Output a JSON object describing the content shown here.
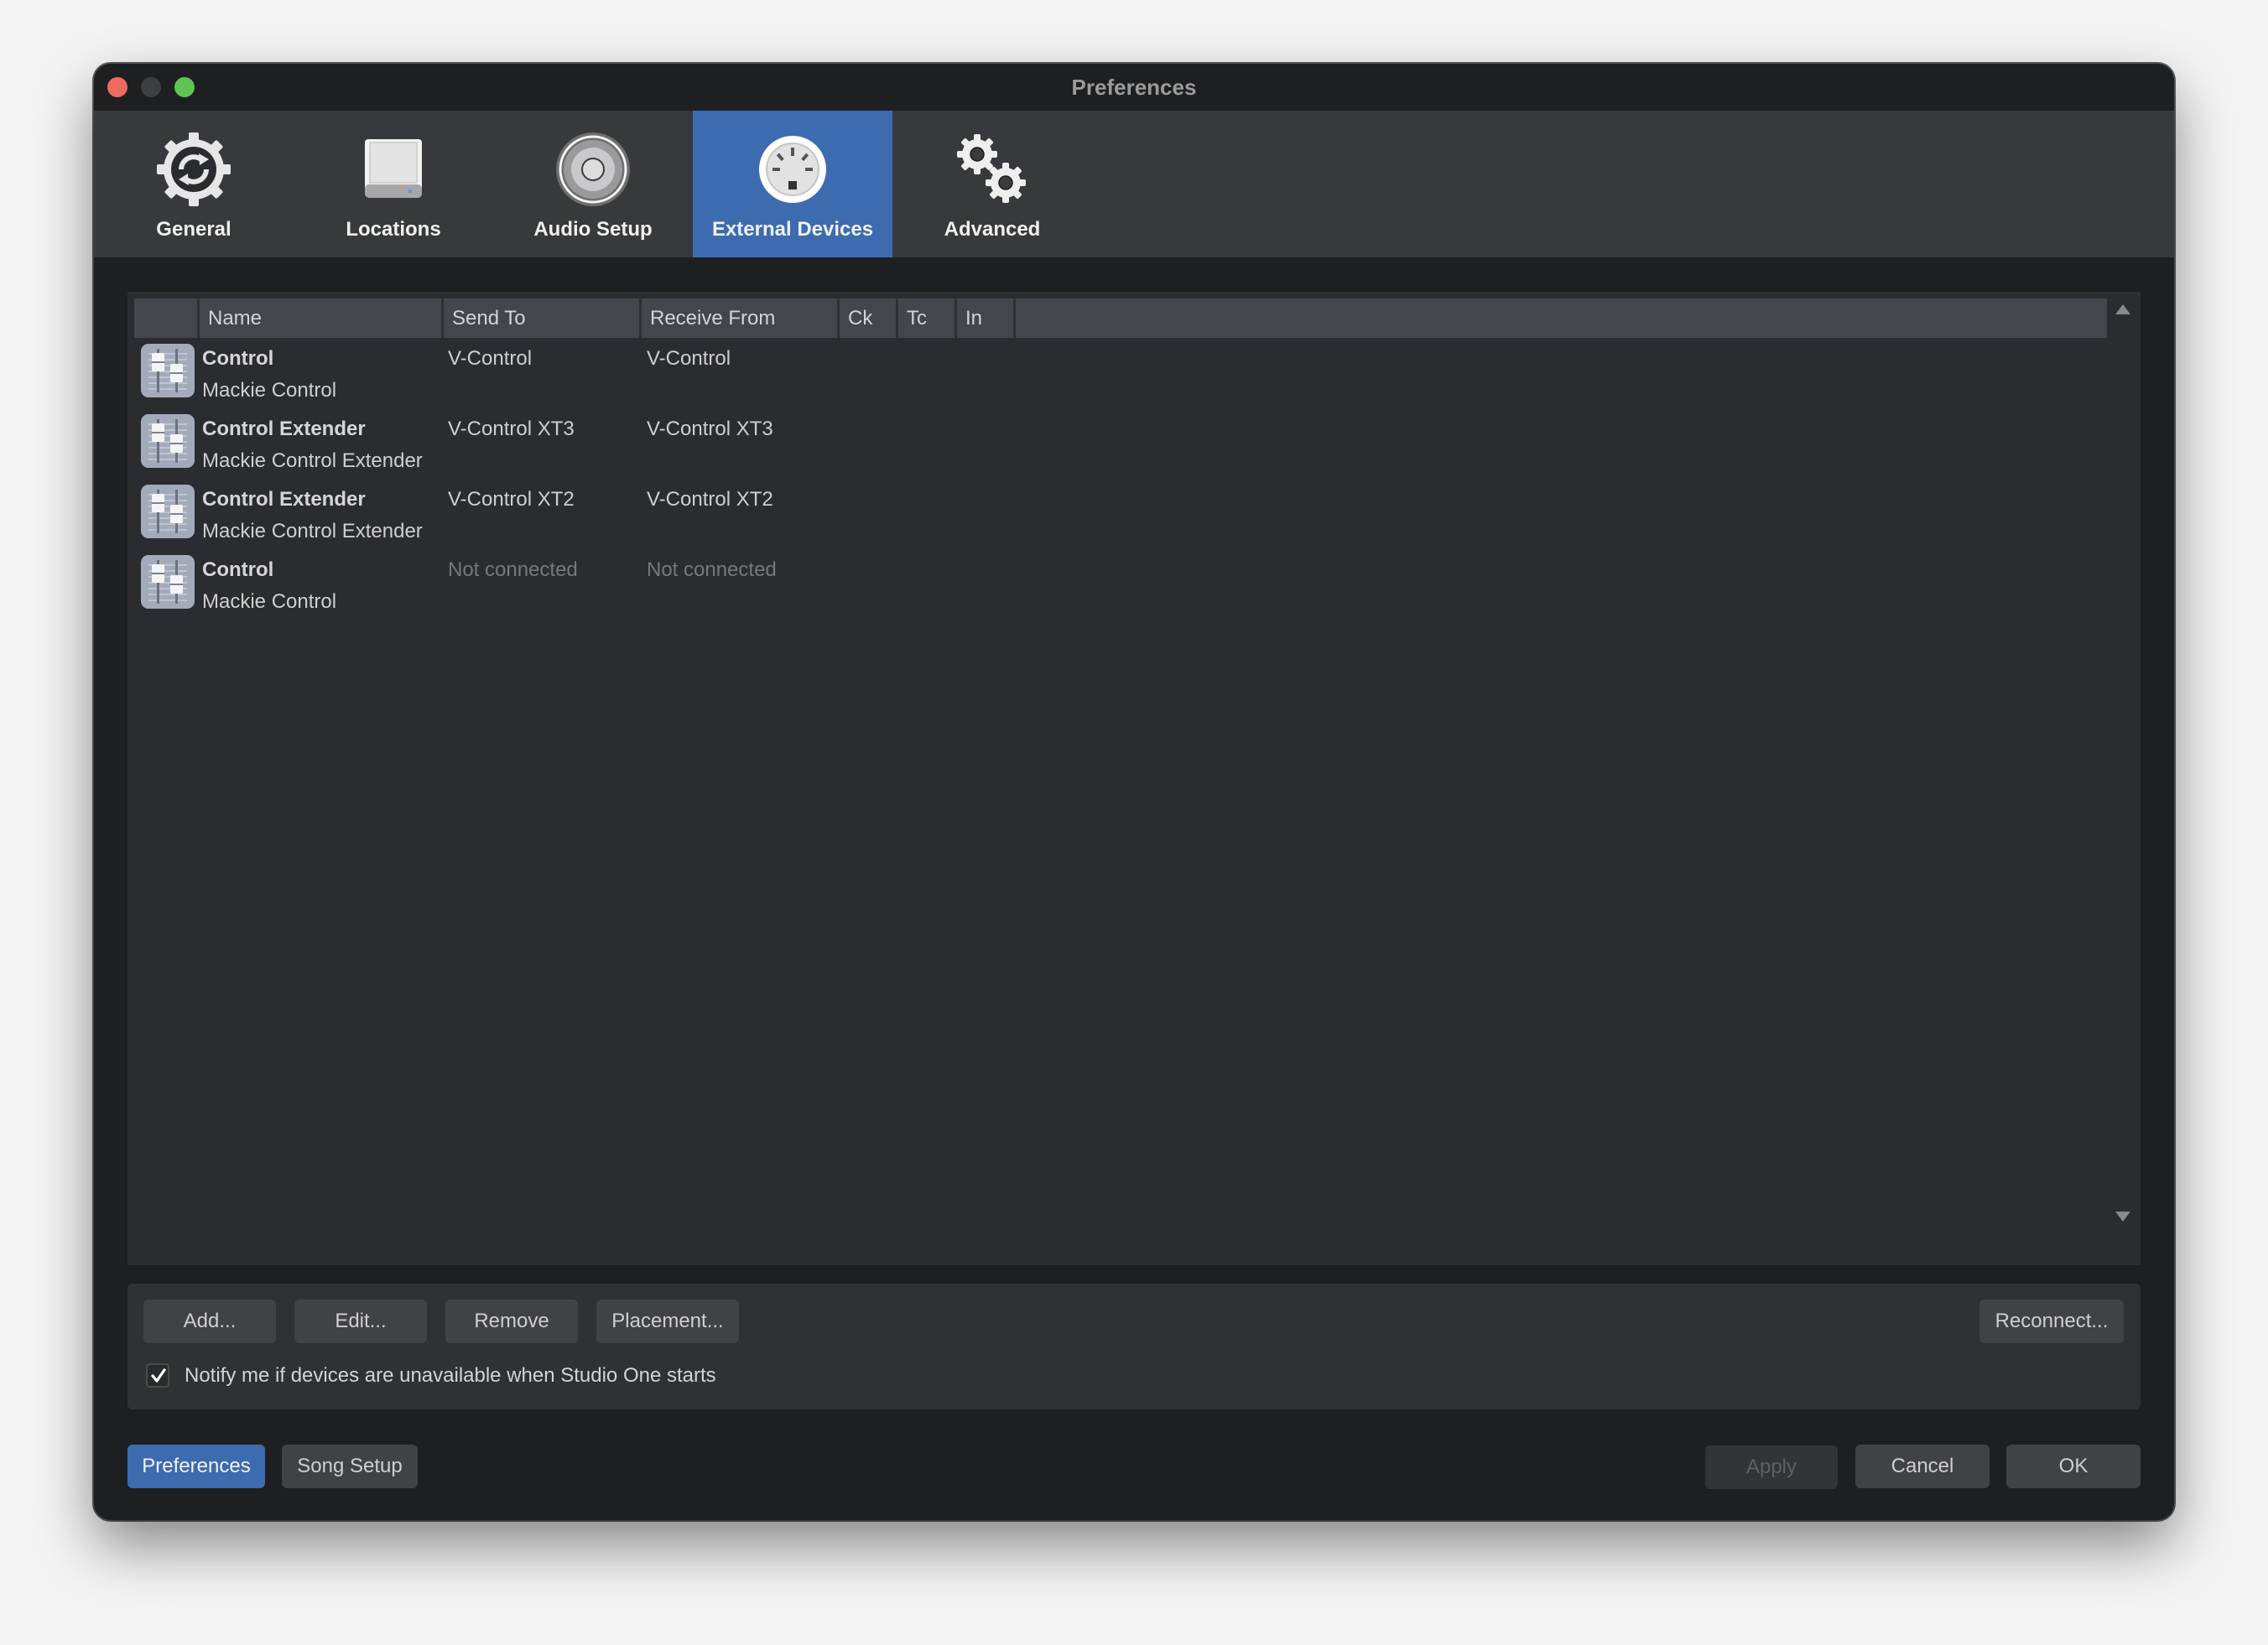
{
  "window": {
    "title": "Preferences"
  },
  "toolbar": {
    "tabs": [
      {
        "label": "General",
        "icon": "gear-sync-icon",
        "active": false
      },
      {
        "label": "Locations",
        "icon": "drive-icon",
        "active": false
      },
      {
        "label": "Audio Setup",
        "icon": "speaker-icon",
        "active": false
      },
      {
        "label": "External Devices",
        "icon": "midi-port-icon",
        "active": true
      },
      {
        "label": "Advanced",
        "icon": "gears-icon",
        "active": false
      }
    ]
  },
  "table": {
    "columns": [
      "",
      "Name",
      "Send To",
      "Receive From",
      "Ck",
      "Tc",
      "In"
    ],
    "rows": [
      {
        "icon": "fader-control-icon",
        "name": "Control",
        "model": "Mackie Control",
        "send_to": "V-Control",
        "receive_from": "V-Control",
        "connected": true
      },
      {
        "icon": "fader-control-icon",
        "name": "Control Extender",
        "model": "Mackie Control Extender",
        "send_to": "V-Control XT3",
        "receive_from": "V-Control XT3",
        "connected": true
      },
      {
        "icon": "fader-control-icon",
        "name": "Control Extender",
        "model": "Mackie Control Extender",
        "send_to": "V-Control XT2",
        "receive_from": "V-Control XT2",
        "connected": true
      },
      {
        "icon": "fader-control-icon",
        "name": "Control",
        "model": "Mackie Control",
        "send_to": "Not connected",
        "receive_from": "Not connected",
        "connected": false
      }
    ]
  },
  "actions": {
    "add": "Add...",
    "edit": "Edit...",
    "remove": "Remove",
    "placement": "Placement...",
    "reconnect": "Reconnect...",
    "notify_label": "Notify me if devices are unavailable when Studio One starts",
    "notify_checked": true
  },
  "footer": {
    "preferences": "Preferences",
    "song_setup": "Song Setup",
    "apply": "Apply",
    "cancel": "Cancel",
    "ok": "OK"
  },
  "colors": {
    "accent": "#3d6bb0",
    "close": "#ee6a5f",
    "zoom": "#5fc454"
  }
}
